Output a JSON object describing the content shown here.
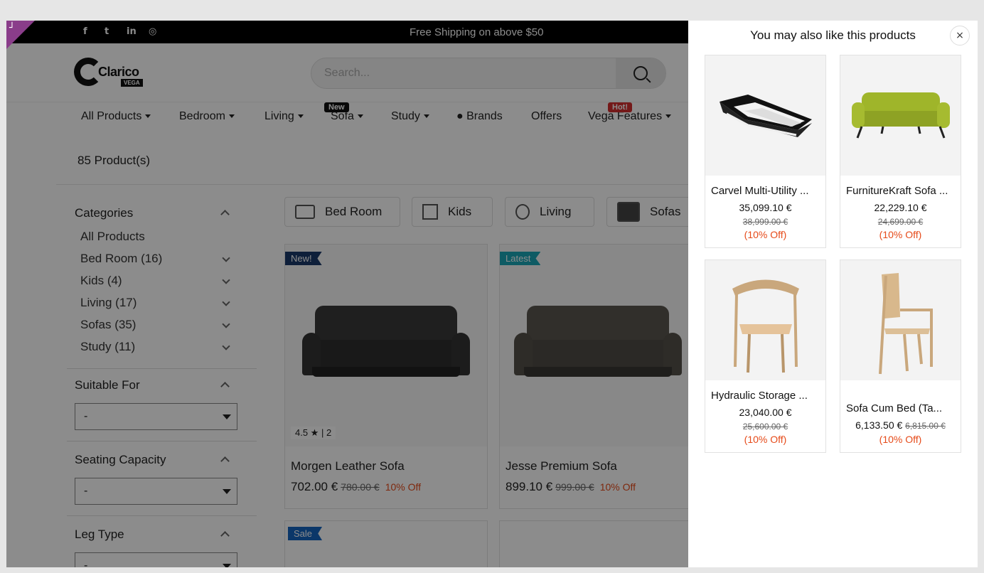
{
  "topbar": {
    "shipping_text": "Free Shipping on above $50",
    "social_icons": [
      "facebook-icon",
      "twitter-icon",
      "linkedin-icon",
      "instagram-icon"
    ],
    "social_glyphs": [
      "f",
      "t",
      "in",
      "◎"
    ]
  },
  "header": {
    "logo_text": "Clarico",
    "logo_sub": "VEGA",
    "search_placeholder": "Search..."
  },
  "nav": {
    "items": [
      {
        "label": "All Products",
        "caret": true
      },
      {
        "label": "Bedroom",
        "caret": true
      },
      {
        "label": "Living",
        "caret": true
      },
      {
        "label": "Sofa",
        "caret": true,
        "badge": "New"
      },
      {
        "label": "Study",
        "caret": true
      },
      {
        "label": "● Brands",
        "caret": false
      },
      {
        "label": "Offers",
        "caret": false
      },
      {
        "label": "Vega Features",
        "caret": true,
        "badge": "Hot!"
      }
    ],
    "badge_colors": {
      "New": "#111111",
      "Hot!": "#d32f2f"
    }
  },
  "listing": {
    "count_text": "85 Product(s)"
  },
  "filters": {
    "categories_title": "Categories",
    "all_products": "All Products",
    "categories": [
      {
        "label": "Bed Room",
        "count": "(16)"
      },
      {
        "label": "Kids",
        "count": "(4)"
      },
      {
        "label": "Living",
        "count": "(17)"
      },
      {
        "label": "Sofas",
        "count": "(35)"
      },
      {
        "label": "Study",
        "count": "(11)"
      }
    ],
    "suitable_for_title": "Suitable For",
    "suitable_for_value": "-",
    "seating_title": "Seating Capacity",
    "seating_value": "-",
    "leg_type_title": "Leg Type",
    "leg_type_value": "-"
  },
  "category_chips": [
    "Bed Room",
    "Kids",
    "Living",
    "Sofas"
  ],
  "products": [
    {
      "ribbon": "New!",
      "ribbon_color": "#1a3a6b",
      "rating": "4.5 ★ | 2",
      "name": "Morgen Leather Sofa",
      "price": "702.00 €",
      "old_price": "780.00 €",
      "off": "10% Off",
      "sofa_color": "#3a3a3a"
    },
    {
      "ribbon": "Latest",
      "ribbon_color": "#1aa6b7",
      "rating": "",
      "name": "Jesse Premium Sofa",
      "price": "899.10 €",
      "old_price": "999.00 €",
      "off": "10% Off",
      "sofa_color": "#5a564f"
    }
  ],
  "products_row2": [
    {
      "ribbon": "Sale",
      "ribbon_color": "#1565c0"
    }
  ],
  "drawer": {
    "title": "You may also like this products",
    "close_label": "×",
    "items": [
      {
        "name": "Carvel Multi-Utility ...",
        "price": "35,099.10 €",
        "old_price": "38,999.00 €",
        "off": "(10% Off)",
        "img": "bed-icon"
      },
      {
        "name": "FurnitureKraft Sofa ...",
        "price": "22,229.10 €",
        "old_price": "24,699.00 €",
        "off": "(10% Off)",
        "img": "green-sofa-icon"
      },
      {
        "name": "Hydraulic Storage ...",
        "price": "23,040.00 €",
        "old_price": "25,600.00 €",
        "off": "(10% Off)",
        "img": "round-chair-icon"
      },
      {
        "name": "Sofa Cum Bed (Ta...",
        "price": "6,133.50 €",
        "old_price": "6,815.00 €",
        "off": "(10% Off)",
        "img": "armchair-icon"
      }
    ]
  }
}
